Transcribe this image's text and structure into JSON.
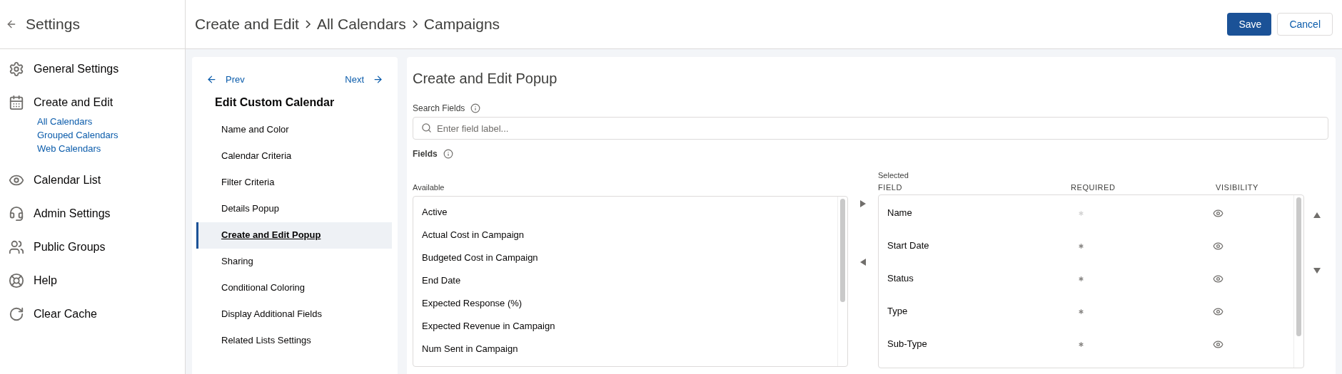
{
  "sidebar": {
    "title": "Settings",
    "items": [
      {
        "label": "General Settings"
      },
      {
        "label": "Create and Edit",
        "children": [
          {
            "label": "All Calendars"
          },
          {
            "label": "Grouped Calendars"
          },
          {
            "label": "Web Calendars"
          }
        ]
      },
      {
        "label": "Calendar List"
      },
      {
        "label": "Admin Settings"
      },
      {
        "label": "Public Groups"
      },
      {
        "label": "Help"
      },
      {
        "label": "Clear Cache"
      }
    ]
  },
  "breadcrumb": [
    "Create and Edit",
    "All Calendars",
    "Campaigns"
  ],
  "buttons": {
    "save": "Save",
    "cancel": "Cancel"
  },
  "steps": {
    "prev": "Prev",
    "next": "Next",
    "title": "Edit Custom Calendar",
    "items": [
      {
        "label": "Name and Color",
        "selected": false
      },
      {
        "label": "Calendar Criteria",
        "selected": false
      },
      {
        "label": "Filter Criteria",
        "selected": false
      },
      {
        "label": "Details Popup",
        "selected": false
      },
      {
        "label": "Create and Edit Popup",
        "selected": true
      },
      {
        "label": "Sharing",
        "selected": false
      },
      {
        "label": "Conditional Coloring",
        "selected": false
      },
      {
        "label": "Display Additional Fields",
        "selected": false
      },
      {
        "label": "Related Lists Settings",
        "selected": false
      }
    ]
  },
  "panel": {
    "title": "Create and Edit Popup",
    "search_label": "Search Fields",
    "search": {
      "placeholder": "Enter field label..."
    },
    "fields_label": "Fields",
    "available": {
      "label": "Available",
      "items": [
        "Active",
        "Actual Cost in Campaign",
        "Budgeted Cost in Campaign",
        "End Date",
        "Expected Response (%)",
        "Expected Revenue in Campaign",
        "Num Sent in Campaign"
      ]
    },
    "selected": {
      "label": "Selected",
      "columns": [
        "FIELD",
        "REQUIRED",
        "VISIBILITY"
      ],
      "rows": [
        {
          "field": "Name",
          "required_disabled": true
        },
        {
          "field": "Start Date",
          "required_disabled": false
        },
        {
          "field": "Status",
          "required_disabled": false
        },
        {
          "field": "Type",
          "required_disabled": false
        },
        {
          "field": "Sub-Type",
          "required_disabled": false
        }
      ]
    }
  }
}
